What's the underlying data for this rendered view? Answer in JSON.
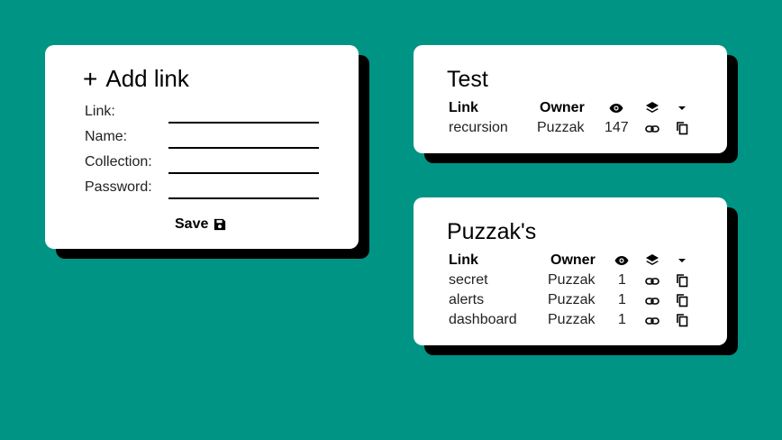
{
  "add_link": {
    "plus": "+",
    "title": "Add link",
    "fields": [
      {
        "label": "Link:",
        "value": ""
      },
      {
        "label": "Name:",
        "value": ""
      },
      {
        "label": "Collection:",
        "value": ""
      },
      {
        "label": "Password:",
        "value": ""
      }
    ],
    "save_label": "Save"
  },
  "collections": [
    {
      "title": "Test",
      "headers": {
        "link": "Link",
        "owner": "Owner"
      },
      "rows": [
        {
          "link": "recursion",
          "owner": "Puzzak",
          "views": "147"
        }
      ]
    },
    {
      "title": "Puzzak's",
      "headers": {
        "link": "Link",
        "owner": "Owner"
      },
      "rows": [
        {
          "link": "secret",
          "owner": "Puzzak",
          "views": "1"
        },
        {
          "link": "alerts",
          "owner": "Puzzak",
          "views": "1"
        },
        {
          "link": "dashboard",
          "owner": "Puzzak",
          "views": "1"
        }
      ]
    }
  ],
  "icons": {
    "header": [
      "eye-icon",
      "layers-icon",
      "caret-down-icon"
    ],
    "row": [
      "link-icon",
      "copy-icon"
    ]
  },
  "colors": {
    "background": "#009485",
    "card": "#ffffff",
    "shadow": "#000000"
  }
}
